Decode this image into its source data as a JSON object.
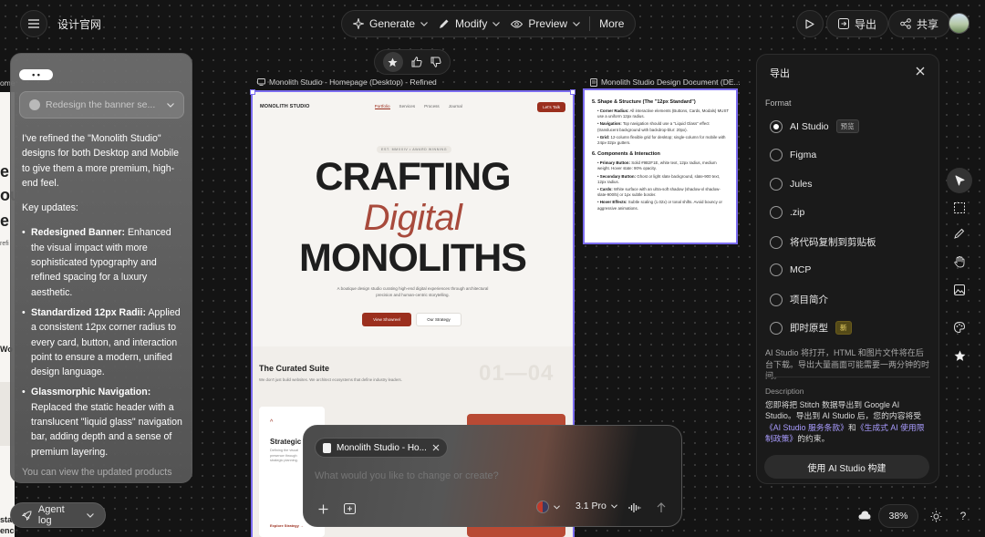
{
  "topbar": {
    "project_title": "设计官网",
    "tools": [
      {
        "label": "Generate",
        "icon": "sparkle-icon"
      },
      {
        "label": "Modify",
        "icon": "pencil-icon"
      },
      {
        "label": "Preview",
        "icon": "eye-icon"
      },
      {
        "label": "More",
        "icon": "more-icon"
      }
    ],
    "export_label": "导出",
    "share_label": "共享"
  },
  "canvas": {
    "left_edge_label": "ome",
    "left_edge_frame_fragments": [
      "e",
      "ou",
      "e",
      "refi",
      "Wo",
      "sta",
      "ence."
    ],
    "frame_desktop": {
      "label": "Monolith Studio - Homepage (Desktop) - Refined",
      "brand": "MONOLITH STUDIO",
      "nav": [
        "Portfolio",
        "Services",
        "Process",
        "Journal"
      ],
      "nav_cta": "Let's Talk",
      "eyebrow": "EST. MMXXIV • AWARD WINNING",
      "hero_line1": "CRAFTING",
      "hero_line2": "Digital",
      "hero_line3": "MONOLITHS",
      "hero_sub": "A boutique design studio curating high-end digital experiences through architectural precision and human-centric storytelling.",
      "cta_primary": "View Showreel",
      "cta_secondary": "Our Strategy",
      "suite_title": "The Curated Suite",
      "suite_sub": "We don't just build websites. We architect ecosystems that define industry leaders.",
      "suite_number": "01—04",
      "card_title": "Strategic",
      "card_text": "Defining the visual presence through strategic planning.",
      "card_link": "Explore Strategy →"
    },
    "frame_doc": {
      "label": "Monolith Studio Design Document (DE...",
      "section5_title": "5. Shape & Structure (The \"12px Standard\")",
      "section5_items": [
        {
          "bold": "Corner Radius:",
          "text": "All interactive elements (Buttons, Cards, Modals) MUST use a uniform 12px radius."
        },
        {
          "bold": "Navigation:",
          "text": "Top navigation should use a \"Liquid Glass\" effect (translucent background with backdrop-blur: 20px)."
        },
        {
          "bold": "Grid:",
          "text": "12-column flexible grid for desktop; single-column for mobile with 24px-32px gutters."
        }
      ],
      "section6_title": "6. Components & Interaction",
      "section6_items": [
        {
          "bold": "Primary Button:",
          "text": "Solid #9B2F1E, white text, 12px radius, medium weight. Hover state: 90% opacity."
        },
        {
          "bold": "Secondary Button:",
          "text": "Ghost or light slate background, slate-900 text, 12px radius."
        },
        {
          "bold": "Cards:",
          "text": "White surface with an ultra-soft shadow (shadow-xl shadow-slate-900/5) or 1px subtle border."
        },
        {
          "bold": "Hover Effects:",
          "text": "Subtle scaling (1.02x) or tonal shifts. Avoid bouncy or aggressive animations."
        }
      ]
    }
  },
  "chat": {
    "bubble": "• •",
    "dropdown_placeholder": "Redesign the banner se...",
    "intro": "I've refined the \"Monolith Studio\" designs for both Desktop and Mobile to give them a more premium, high-end feel.",
    "updates_heading": "Key updates:",
    "updates": [
      {
        "title": "Redesigned Banner:",
        "text": "Enhanced the visual impact with more sophisticated typography and refined spacing for a luxury aesthetic."
      },
      {
        "title": "Standardized 12px Radii:",
        "text": "Applied a consistent 12px corner radius to every card, button, and interaction point to ensure a modern, unified design language."
      },
      {
        "title": "Glassmorphic Navigation:",
        "text": "Replaced the static header with a translucent \"liquid glass\" navigation bar, adding depth and a sense of premium layering."
      }
    ],
    "trailing": "You can view the updated products",
    "agent_log": "Agent log"
  },
  "vote_bar": {
    "star": "star-icon",
    "up": "thumbs-up-icon",
    "down": "thumbs-down-icon"
  },
  "export_panel": {
    "title": "导出",
    "format_label": "Format",
    "options": [
      {
        "label": "AI Studio",
        "tag": "预览",
        "selected": true
      },
      {
        "label": "Figma",
        "tag": "",
        "selected": false
      },
      {
        "label": "Jules",
        "tag": "",
        "selected": false
      },
      {
        "label": ".zip",
        "tag": "",
        "selected": false
      },
      {
        "label": "将代码复制到剪贴板",
        "tag": "",
        "selected": false
      },
      {
        "label": "MCP",
        "tag": "",
        "selected": false
      },
      {
        "label": "项目简介",
        "tag": "",
        "selected": false
      },
      {
        "label": "即时原型",
        "tag": "新",
        "selected": false
      }
    ],
    "note": "AI Studio 将打开，HTML 和图片文件将在后台下载。导出大量画面可能需要一两分钟的时间。",
    "description_label": "Description",
    "desc_prefix": "您即将把 Stitch 数据导出到 Google AI Studio。导出到 AI Studio 后，您的内容将受",
    "desc_link1": "《AI Studio 服务条款》",
    "desc_mid": "和",
    "desc_link2": "《生成式 AI 使用限制政策》",
    "desc_suffix": "的约束。",
    "build_button": "使用 AI Studio 构建"
  },
  "prompt_box": {
    "chip_label": "Monolith Studio - Ho...",
    "placeholder": "What would you like to change or create?",
    "model": "3.1 Pro"
  },
  "bottom_right": {
    "zoom": "38%",
    "help": "?"
  },
  "colors": {
    "accent_red": "#9B2F1E",
    "selection": "#7b6cf0",
    "link_purple": "#a99cff"
  }
}
